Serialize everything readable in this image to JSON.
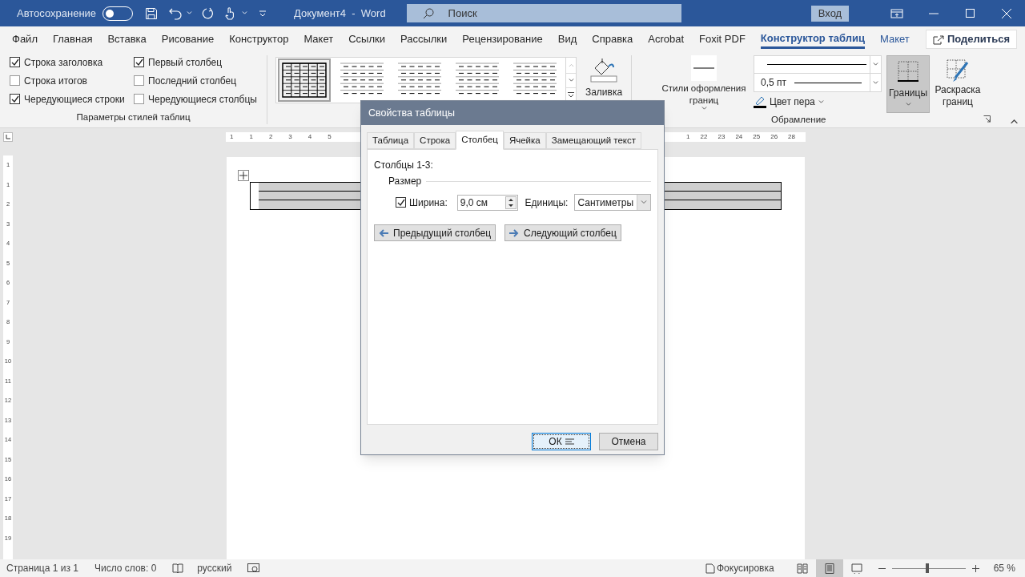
{
  "title_bar": {
    "autosave_label": "Автосохранение",
    "autosave_on": false,
    "document_title": "Документ4  -  Word",
    "search_placeholder": "Поиск",
    "signin": "Вход"
  },
  "menu_tabs": [
    {
      "label": "Файл",
      "selected": false
    },
    {
      "label": "Главная",
      "selected": false
    },
    {
      "label": "Вставка",
      "selected": false
    },
    {
      "label": "Рисование",
      "selected": false
    },
    {
      "label": "Конструктор",
      "selected": false
    },
    {
      "label": "Макет",
      "selected": false
    },
    {
      "label": "Ссылки",
      "selected": false
    },
    {
      "label": "Рассылки",
      "selected": false
    },
    {
      "label": "Рецензирование",
      "selected": false
    },
    {
      "label": "Вид",
      "selected": false
    },
    {
      "label": "Справка",
      "selected": false
    },
    {
      "label": "Acrobat",
      "selected": false
    },
    {
      "label": "Foxit PDF",
      "selected": false
    },
    {
      "label": "Конструктор таблиц",
      "selected": true
    },
    {
      "label": "Макет",
      "selected": false
    }
  ],
  "share_button": "Поделиться",
  "style_options": {
    "label": "Параметры стилей таблиц",
    "items": [
      {
        "label": "Строка заголовка",
        "checked": true
      },
      {
        "label": "Строка итогов",
        "checked": false
      },
      {
        "label": "Чередующиеся строки",
        "checked": true
      },
      {
        "label": "Первый столбец",
        "checked": true
      },
      {
        "label": "Последний столбец",
        "checked": false
      },
      {
        "label": "Чередующиеся столбцы",
        "checked": false
      }
    ]
  },
  "table_styles": [
    {
      "selected": true
    },
    {
      "selected": false
    },
    {
      "selected": false
    },
    {
      "selected": false
    },
    {
      "selected": false
    }
  ],
  "shading_button": "Заливка",
  "borders_group": {
    "label": "Обрамление",
    "border_styles": "Стили оформления границ",
    "pen_weight": "0,5 пт",
    "pen_color": "Цвет пера",
    "borders": {
      "label": "Границы",
      "selected": true
    },
    "border_painter": "Раскраска границ"
  },
  "ruler": {
    "left_labels": [
      "1",
      "1",
      "2",
      "3",
      "4",
      "5"
    ],
    "right_labels": [
      "1",
      "22",
      "23",
      "24",
      "25",
      "26",
      "28"
    ],
    "vertical_labels": [
      "1",
      "1",
      "2",
      "3",
      "4",
      "5",
      "6",
      "7",
      "8",
      "9",
      "10",
      "11",
      "12",
      "13",
      "14",
      "15",
      "16",
      "17",
      "18",
      "19"
    ]
  },
  "dialog": {
    "title": "Свойства таблицы",
    "tabs": [
      {
        "label": "Таблица",
        "selected": false
      },
      {
        "label": "Строка",
        "selected": false
      },
      {
        "label": "Столбец",
        "selected": true
      },
      {
        "label": "Ячейка",
        "selected": false
      },
      {
        "label": "Замещающий текст",
        "selected": false
      }
    ],
    "columns_label": "Столбцы 1-3:",
    "size_label": "Размер",
    "width_label": "Ширина:",
    "width_checked": true,
    "width_value": "9,0 см",
    "units_label": "Единицы:",
    "units_value": "Сантиметры",
    "prev_button": "Предыдущий столбец",
    "next_button": "Следующий столбец",
    "ok": "ОК",
    "cancel": "Отмена"
  },
  "status_bar": {
    "page": "Страница 1 из 1",
    "words": "Число слов: 0",
    "language": "русский",
    "focus": "Фокусировка",
    "views": [
      {
        "kind": "read",
        "selected": false
      },
      {
        "kind": "print",
        "selected": true
      },
      {
        "kind": "web",
        "selected": false
      }
    ],
    "zoom": {
      "level": 0.48,
      "reading": "65 %"
    }
  }
}
